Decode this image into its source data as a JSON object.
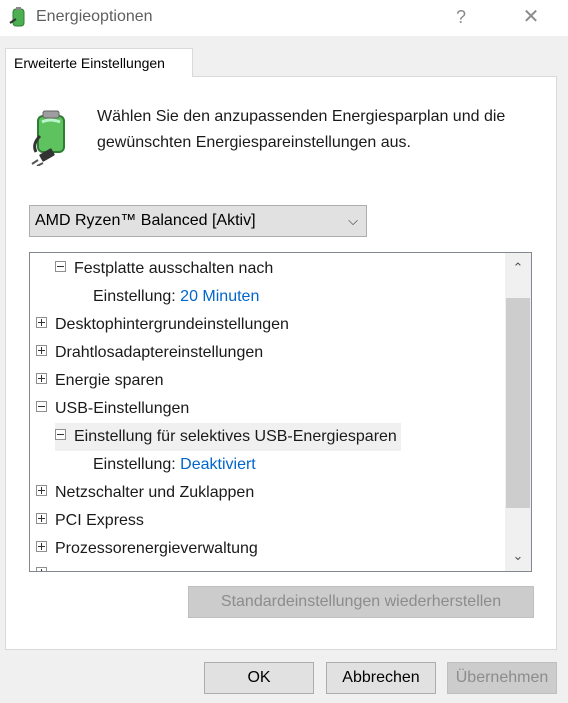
{
  "window": {
    "title": "Energieoptionen",
    "help": "?",
    "close": "✕"
  },
  "tab": {
    "label": "Erweiterte Einstellungen"
  },
  "intro": {
    "text": "Wählen Sie den anzupassenden Energiesparplan und die gewünschten Energiespareinstellungen aus."
  },
  "plan": {
    "selected": "AMD Ryzen™ Balanced [Aktiv]"
  },
  "tree": {
    "items": [
      {
        "label": "Festplatte ausschalten nach",
        "state": "expanded"
      },
      {
        "prefix": "Einstellung:",
        "value": "20 Minuten"
      },
      {
        "label": "Desktophintergrundeinstellungen",
        "state": "collapsed"
      },
      {
        "label": "Drahtlosadaptereinstellungen",
        "state": "collapsed"
      },
      {
        "label": "Energie sparen",
        "state": "collapsed"
      },
      {
        "label": "USB-Einstellungen",
        "state": "expanded"
      },
      {
        "label": "Einstellung für selektives USB-Energiesparen",
        "state": "expanded",
        "selected": true
      },
      {
        "prefix": "Einstellung:",
        "value": "Deaktiviert"
      },
      {
        "label": "Netzschalter und Zuklappen",
        "state": "collapsed"
      },
      {
        "label": "PCI Express",
        "state": "collapsed"
      },
      {
        "label": "Prozessorenergieverwaltung",
        "state": "collapsed"
      }
    ]
  },
  "buttons": {
    "restore": "Standardeinstellungen wiederherstellen",
    "ok": "OK",
    "cancel": "Abbrechen",
    "apply": "Übernehmen"
  },
  "colors": {
    "link": "#0066cc",
    "accent": "#4caf50"
  }
}
